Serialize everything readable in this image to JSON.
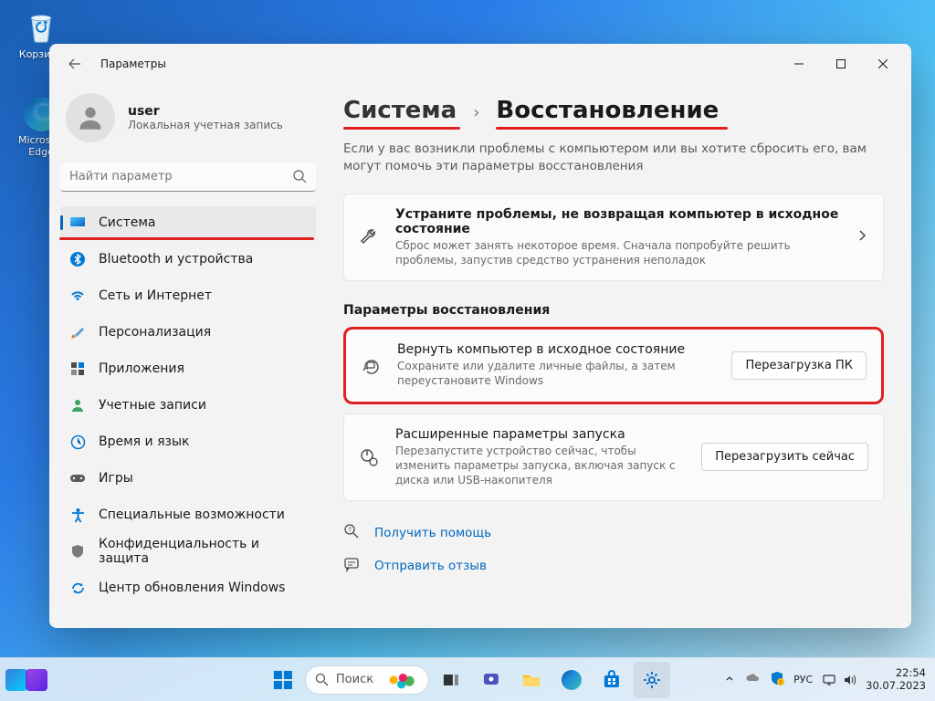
{
  "desktop": {
    "recycle_label": "Корзина",
    "edge_label": "Microsoft Edge"
  },
  "window": {
    "title": "Параметры",
    "user": {
      "name": "user",
      "subtitle": "Локальная учетная запись"
    },
    "search_placeholder": "Найти параметр",
    "nav": [
      {
        "label": "Система"
      },
      {
        "label": "Bluetooth и устройства"
      },
      {
        "label": "Сеть и Интернет"
      },
      {
        "label": "Персонализация"
      },
      {
        "label": "Приложения"
      },
      {
        "label": "Учетные записи"
      },
      {
        "label": "Время и язык"
      },
      {
        "label": "Игры"
      },
      {
        "label": "Специальные возможности"
      },
      {
        "label": "Конфиденциальность и защита"
      },
      {
        "label": "Центр обновления Windows"
      }
    ],
    "breadcrumb": {
      "parent": "Система",
      "current": "Восстановление"
    },
    "description": "Если у вас возникли проблемы с компьютером или вы хотите сбросить его, вам могут помочь эти параметры восстановления",
    "troubleshoot": {
      "title": "Устраните проблемы, не возвращая компьютер в исходное состояние",
      "subtitle": "Сброс может занять некоторое время. Сначала попробуйте решить проблемы, запустив средство устранения неполадок"
    },
    "section_title": "Параметры восстановления",
    "reset": {
      "title": "Вернуть компьютер в исходное состояние",
      "subtitle": "Сохраните или удалите личные файлы, а затем переустановите Windows",
      "button": "Перезагрузка ПК"
    },
    "advanced": {
      "title": "Расширенные параметры запуска",
      "subtitle": "Перезапустите устройство сейчас, чтобы изменить параметры запуска, включая запуск с диска или USB-накопителя",
      "button": "Перезагрузить сейчас"
    },
    "help_link": "Получить помощь",
    "feedback_link": "Отправить отзыв"
  },
  "taskbar": {
    "search_placeholder": "Поиск",
    "lang": "РУС",
    "time": "22:54",
    "date": "30.07.2023"
  }
}
